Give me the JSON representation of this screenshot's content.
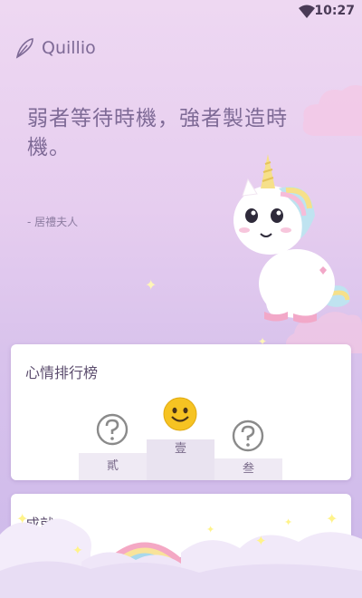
{
  "status_bar": {
    "time": "10:27"
  },
  "header": {
    "app_name": "Quillio",
    "logo_icon": "feather-icon"
  },
  "quote": {
    "text": "弱者等待時機，強者製造時機。",
    "author": "- 居禮夫人"
  },
  "mood_ranking": {
    "title": "心情排行榜",
    "podium": [
      {
        "rank": "壹",
        "icon": "smiley-face-icon"
      },
      {
        "rank": "貳",
        "icon": "question-mark-icon"
      },
      {
        "rank": "叁",
        "icon": "question-mark-icon"
      }
    ]
  },
  "achievements": {
    "title": "成就"
  },
  "colors": {
    "accent_text": "#7e6a96",
    "background_top": "#eed8f2",
    "background_bottom": "#cdb9ea",
    "card": "#ffffff",
    "smiley": "#f6c322"
  }
}
